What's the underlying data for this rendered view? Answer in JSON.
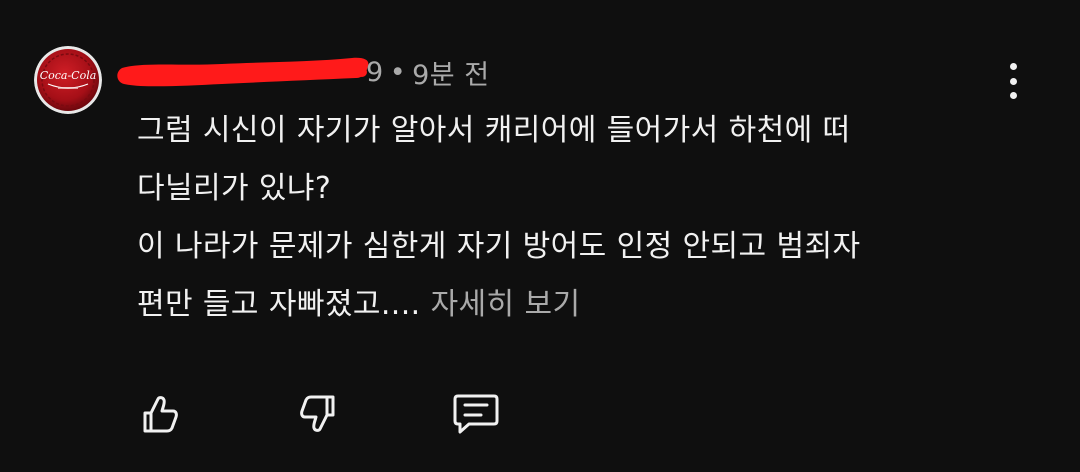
{
  "comment": {
    "avatar": {
      "icon": "coca-cola-bottle-cap-avatar",
      "brand_text": "Coca-Cola"
    },
    "author": {
      "redacted": true
    },
    "meta": {
      "partial": "9",
      "separator": "•",
      "time": "9분 전"
    },
    "menu": {
      "icon": "more-vertical-icon"
    },
    "body": {
      "lines": [
        "그럼 시신이 자기가 알아서 캐리어에 들어가서 하천에 떠",
        "다닐리가 있냐?",
        "이 나라가 문제가 심한게 자기 방어도 인정 안되고 범죄자",
        "편만 들고 자빠졌고...."
      ],
      "read_more": "자세히 보기"
    },
    "actions": [
      {
        "name": "like",
        "icon": "thumbs-up-icon"
      },
      {
        "name": "dislike",
        "icon": "thumbs-down-icon"
      },
      {
        "name": "reply",
        "icon": "comment-icon"
      }
    ]
  },
  "colors": {
    "background": "#0f0f0f",
    "primary_text": "#f1f1f1",
    "secondary_text": "#aaaaaa",
    "redaction": "#ff1a1a",
    "avatar_red": "#b3121a"
  }
}
